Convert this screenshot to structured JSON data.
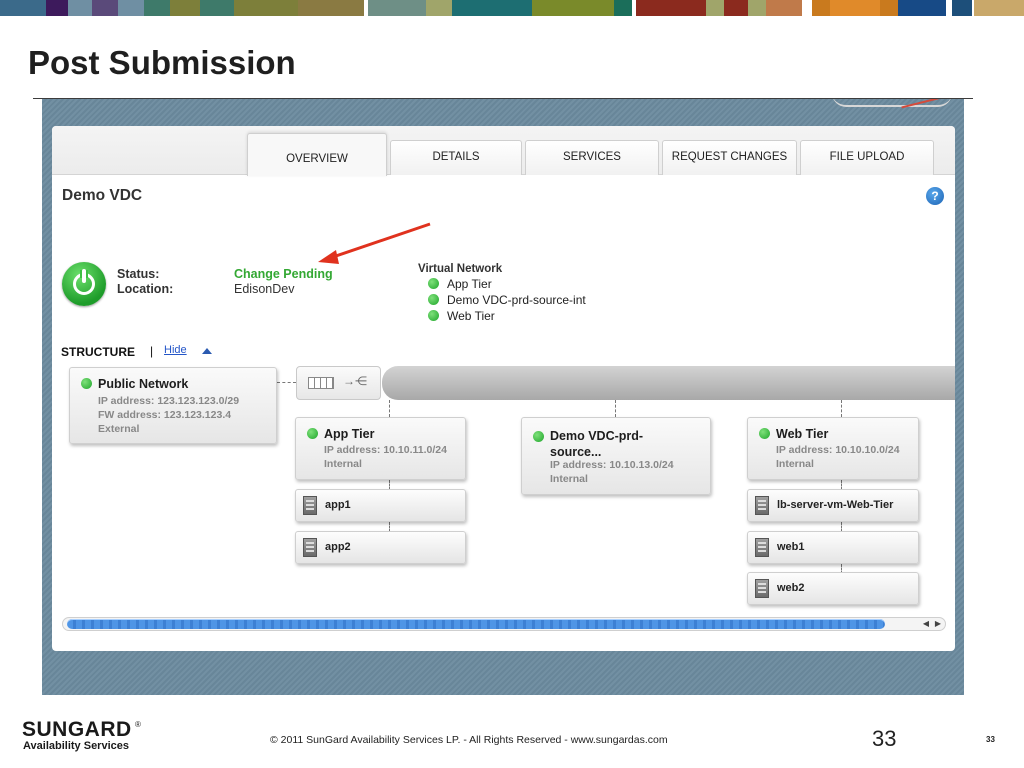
{
  "slide": {
    "title": "Post Submission",
    "footer_logo": "SUNGARD",
    "footer_logo_reg": "®",
    "footer_logo_sub": "Availability Services",
    "copyright": "© 2011 SunGard Availability Services LP. - All Rights Reserved - www.sungardas.com",
    "slide_number_large": "33",
    "slide_number_small": "33"
  },
  "colors": {
    "strip": [
      "#3b6a8a",
      "#3d1a5c",
      "#6f8fa3",
      "#5a4a7a",
      "#3e7a6a",
      "#7d7f3a",
      "#3e7a6a",
      "#7d7f3a",
      "#8a7a42",
      "#6e8f86",
      "#a0a56a",
      "#1d6e72",
      "#7a8a2a",
      "#1b6e5a",
      "#8b2a1e",
      "#6f8a63",
      "#8b2a1e",
      "#7f6a4a",
      "#c05a2a",
      "#c97a1e",
      "#e08a2a",
      "#1d4f7a",
      "#174a86",
      "#c9a86a"
    ],
    "status_green": "#33a833",
    "link_blue": "#2456c8"
  },
  "tabs": [
    {
      "label": "OVERVIEW",
      "active": true
    },
    {
      "label": "DETAILS",
      "active": false
    },
    {
      "label": "SERVICES",
      "active": false
    },
    {
      "label": "REQUEST CHANGES",
      "active": false
    },
    {
      "label": "FILE UPLOAD",
      "active": false
    }
  ],
  "vdc": {
    "name": "Demo VDC",
    "help_icon": "?",
    "status_label": "Status:",
    "status_value": "Change Pending",
    "location_label": "Location:",
    "location_value": "EdisonDev"
  },
  "virtual_network": {
    "title": "Virtual Network",
    "items": [
      "App Tier",
      "Demo VDC-prd-source-int",
      "Web Tier"
    ]
  },
  "structure": {
    "label": "STRUCTURE",
    "separator": "|",
    "hide_link": "Hide",
    "public_network": {
      "name": "Public Network",
      "ip": "IP address: 123.123.123.0/29",
      "fw": "FW address: 123.123.123.4",
      "type": "External"
    },
    "tiers": [
      {
        "name": "App Tier",
        "ip": "IP address: 10.10.11.0/24",
        "type": "Internal",
        "vms": [
          "app1",
          "app2"
        ]
      },
      {
        "name_line1": "Demo VDC-prd-",
        "name_line2": "source...",
        "ip": "IP address: 10.10.13.0/24",
        "type": "Internal",
        "vms": []
      },
      {
        "name": "Web Tier",
        "ip": "IP address: 10.10.10.0/24",
        "type": "Internal",
        "vms": [
          "lb-server-vm-Web-Tier",
          "web1",
          "web2"
        ]
      }
    ]
  }
}
